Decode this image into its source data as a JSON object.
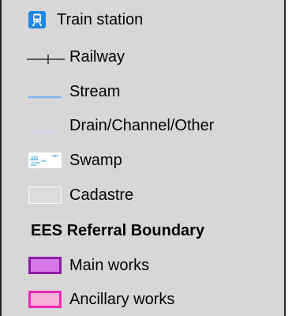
{
  "legend": {
    "items": [
      {
        "label": "Train station",
        "icon": "train-station-icon",
        "color": "#1e88e5"
      },
      {
        "label": "Railway",
        "icon": "railway-line-icon",
        "color": "#333333"
      },
      {
        "label": "Stream",
        "icon": "stream-line-icon",
        "color": "#7fb2f0"
      },
      {
        "label": "Drain/Channel/Other",
        "icon": "drain-line-icon",
        "color": "#c8d6ee"
      },
      {
        "label": "Swamp",
        "icon": "swamp-icon",
        "color": "#7fc6ee"
      },
      {
        "label": "Cadastre",
        "icon": "cadastre-icon",
        "color": "#f0f0f0"
      }
    ],
    "boundary_heading": "EES Referral Boundary",
    "boundary_items": [
      {
        "label": "Main works",
        "icon": "main-works-swatch-icon",
        "fill": "#d878e8",
        "stroke": "#8e1aa8"
      },
      {
        "label": "Ancillary works",
        "icon": "ancillary-works-swatch-icon",
        "fill": "#f7b0d8",
        "stroke": "#ee28b4"
      }
    ]
  }
}
